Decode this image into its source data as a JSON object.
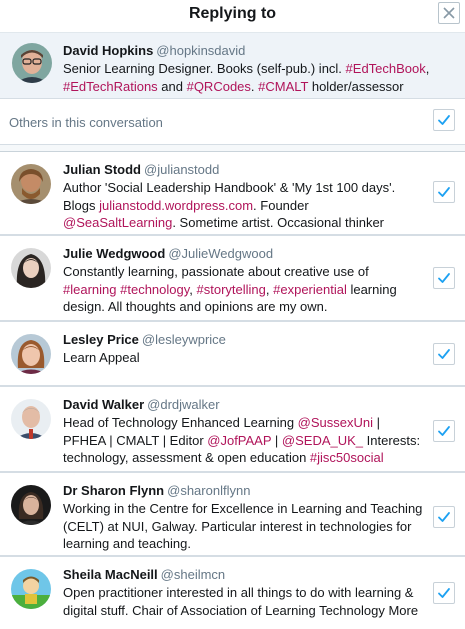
{
  "dialog": {
    "title": "Replying to",
    "close_icon": "close-icon"
  },
  "main_user": {
    "name": "David Hopkins",
    "handle": "@hopkinsdavid",
    "bio_parts": [
      {
        "t": "Senior Learning Designer. Books (self-pub.) incl. ",
        "link": false
      },
      {
        "t": "#EdTechBook",
        "link": true
      },
      {
        "t": ", ",
        "link": false
      },
      {
        "t": "#EdTechRations",
        "link": true
      },
      {
        "t": " and ",
        "link": false
      },
      {
        "t": "#QRCodes",
        "link": true
      },
      {
        "t": ". ",
        "link": false
      },
      {
        "t": "#CMALT",
        "link": true
      },
      {
        "t": " holder/assessor",
        "link": false
      }
    ]
  },
  "others": {
    "label": "Others in this conversation",
    "checked": true
  },
  "users": [
    {
      "name": "Julian Stodd",
      "handle": "@julianstodd",
      "checked": true,
      "bio_parts": [
        {
          "t": "Author 'Social Leadership Handbook' & 'My 1st 100 days'. Blogs ",
          "link": false
        },
        {
          "t": "julianstodd.wordpress.com",
          "link": true
        },
        {
          "t": ". Founder ",
          "link": false
        },
        {
          "t": "@SeaSaltLearning",
          "link": true
        },
        {
          "t": ". Sometime artist. Occasional thinker",
          "link": false
        }
      ]
    },
    {
      "name": "Julie Wedgwood",
      "handle": "@JulieWedgwood",
      "checked": true,
      "bio_parts": [
        {
          "t": "Constantly learning, passionate about creative use of ",
          "link": false
        },
        {
          "t": "#learning",
          "link": true
        },
        {
          "t": " ",
          "link": false
        },
        {
          "t": "#technology",
          "link": true
        },
        {
          "t": ", ",
          "link": false
        },
        {
          "t": "#storytelling",
          "link": true
        },
        {
          "t": ", ",
          "link": false
        },
        {
          "t": "#experiential",
          "link": true
        },
        {
          "t": " learning design. All thoughts and opinions are my own.",
          "link": false
        }
      ]
    },
    {
      "name": "Lesley Price",
      "handle": "@lesleywprice",
      "checked": true,
      "bio_parts": [
        {
          "t": "Learn Appeal",
          "link": false
        }
      ]
    },
    {
      "name": "David Walker",
      "handle": "@drdjwalker",
      "checked": true,
      "bio_parts": [
        {
          "t": "Head of Technology Enhanced Learning ",
          "link": false
        },
        {
          "t": "@SussexUni",
          "link": true
        },
        {
          "t": " | PFHEA | CMALT | Editor ",
          "link": false
        },
        {
          "t": "@JofPAAP",
          "link": true
        },
        {
          "t": " | ",
          "link": false
        },
        {
          "t": "@SEDA_UK_",
          "link": true
        },
        {
          "t": " Interests: technology, assessment & open education ",
          "link": false
        },
        {
          "t": "#jisc50social",
          "link": true
        }
      ]
    },
    {
      "name": "Dr Sharon Flynn",
      "handle": "@sharonlflynn",
      "checked": true,
      "bio_parts": [
        {
          "t": "Working in the Centre for Excellence in Learning and Teaching (CELT) at NUI, Galway. Particular interest in technologies for learning and teaching.",
          "link": false
        }
      ]
    },
    {
      "name": "Sheila MacNeill",
      "handle": "@sheilmcn",
      "checked": true,
      "bio_parts": [
        {
          "t": "Open practitioner interested in all things to do with learning & digital stuff. Chair of Association of Learning Technology More",
          "link": false
        }
      ]
    }
  ],
  "colors": {
    "accent": "#1da1f2",
    "link": "#b0145a",
    "muted": "#657786",
    "highlight_bg": "#eef3f8"
  },
  "icons": {
    "close": "close-icon",
    "check": "checkmark-icon",
    "avatar": "avatar-image"
  }
}
